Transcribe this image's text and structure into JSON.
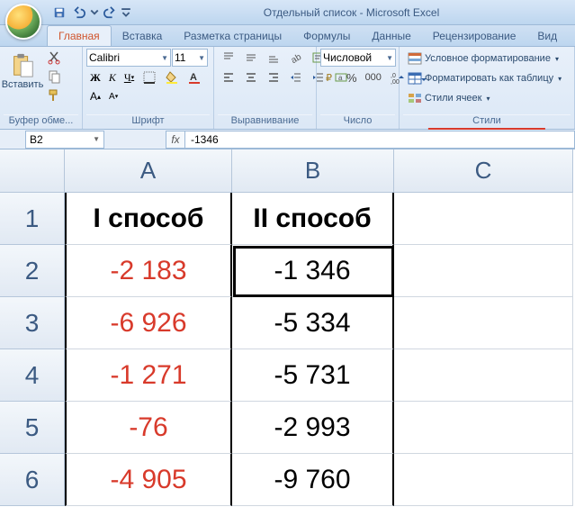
{
  "title": "Отдельный список - Microsoft Excel",
  "qat": {
    "save": "save-icon",
    "undo": "undo-icon",
    "redo": "redo-icon"
  },
  "tabs": [
    "Главная",
    "Вставка",
    "Разметка страницы",
    "Формулы",
    "Данные",
    "Рецензирование",
    "Вид"
  ],
  "active_tab": 0,
  "clipboard": {
    "paste": "Вставить",
    "label": "Буфер обме..."
  },
  "font": {
    "name": "Calibri",
    "size": "11",
    "label": "Шрифт"
  },
  "alignment": {
    "label": "Выравнивание"
  },
  "number": {
    "format": "Числовой",
    "label": "Число"
  },
  "styles": {
    "cond": "Условное форматирование",
    "table": "Форматировать как таблицу",
    "cell": "Стили ячеек",
    "label": "Стили"
  },
  "namebox": "B2",
  "formula": "-1346",
  "columns": [
    "A",
    "B",
    "C"
  ],
  "rows": [
    "1",
    "2",
    "3",
    "4",
    "5",
    "6"
  ],
  "cells": {
    "A1": "I способ",
    "B1": "II способ",
    "A2": "-2 183",
    "B2": "-1 346",
    "A3": "-6 926",
    "B3": "-5 334",
    "A4": "-1 271",
    "B4": "-5 731",
    "A5": "-76",
    "B5": "-2 993",
    "A6": "-4 905",
    "B6": "-9 760"
  },
  "chart_data": {
    "type": "table",
    "title": "Отдельный список",
    "columns": [
      "I способ",
      "II способ"
    ],
    "rows": [
      [
        -2183,
        -1346
      ],
      [
        -6926,
        -5334
      ],
      [
        -1271,
        -5731
      ],
      [
        -76,
        -2993
      ],
      [
        -4905,
        -9760
      ]
    ]
  }
}
